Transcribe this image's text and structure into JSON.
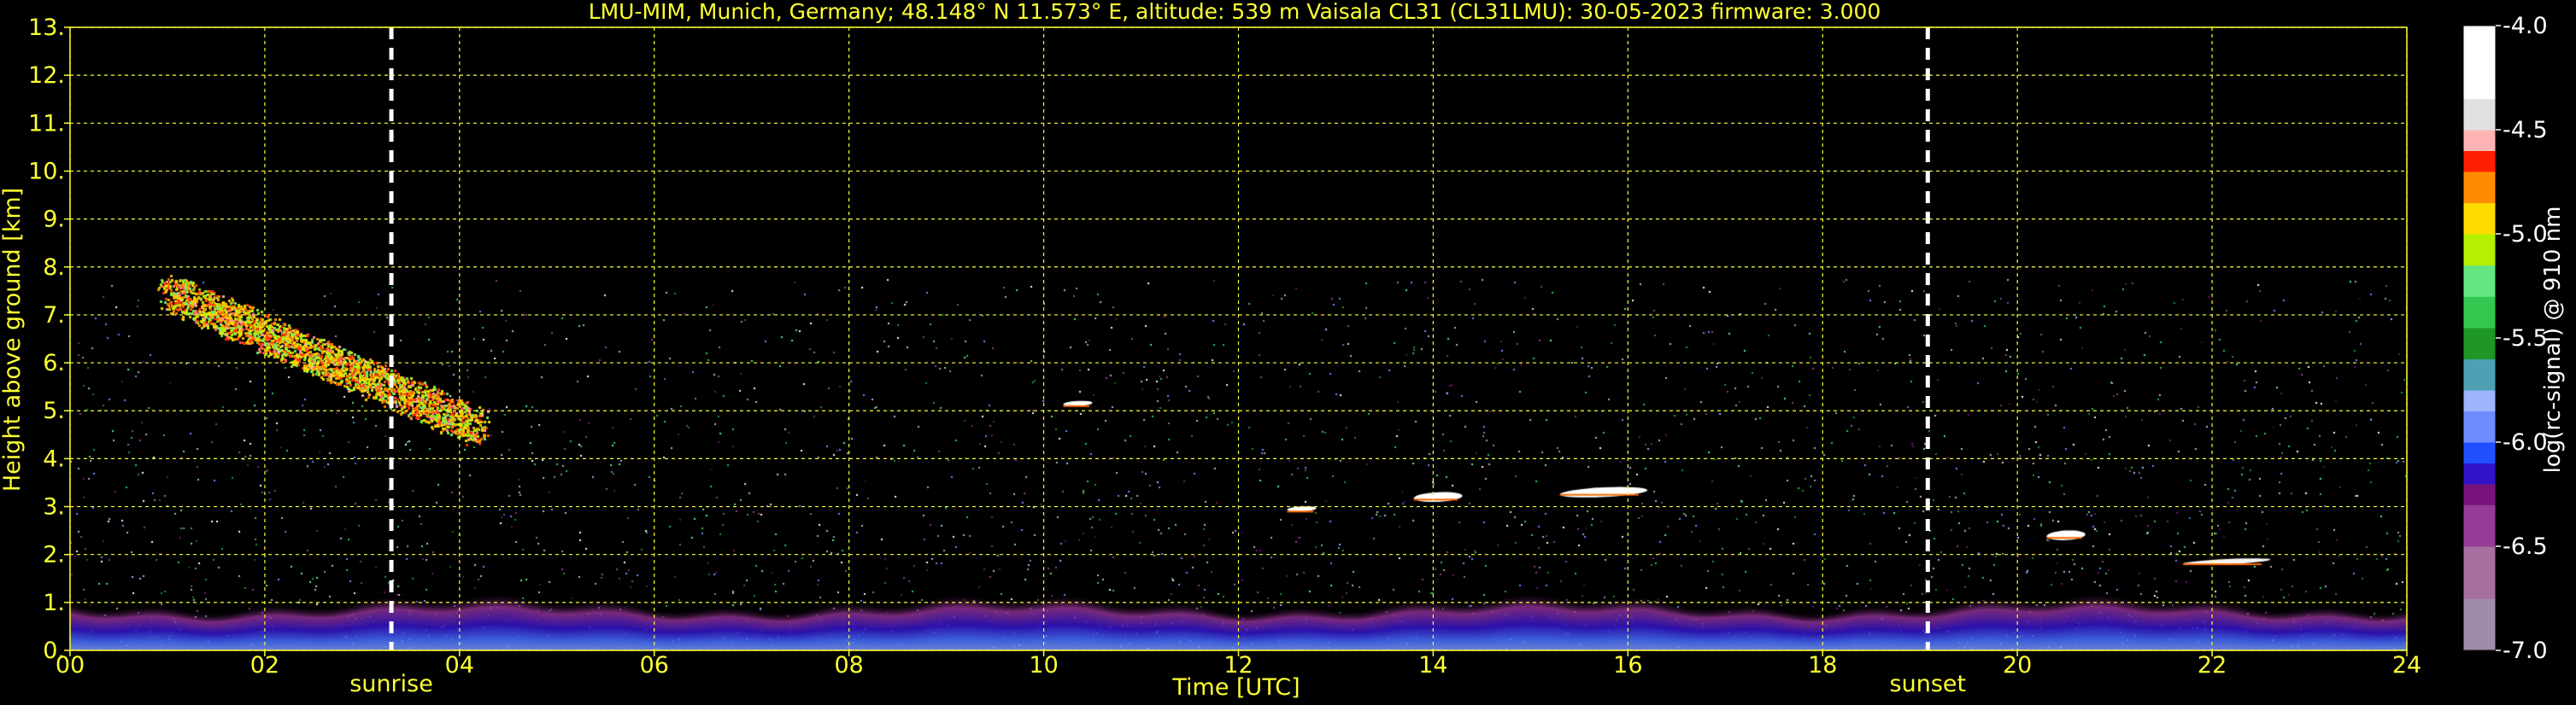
{
  "chart_data": {
    "type": "heatmap",
    "title": "LMU-MIM, Munich, Germany; 48.148° N 11.573° E, altitude: 539 m    Vaisala CL31 (CL31LMU): 30-05-2023    firmware: 3.000",
    "xlabel": "Time [UTC]",
    "ylabel": "Height above ground [km]",
    "xlim": [
      0,
      24
    ],
    "ylim": [
      0,
      13
    ],
    "x_tick_labels": [
      "00",
      "02",
      "04",
      "06",
      "08",
      "10",
      "12",
      "14",
      "16",
      "18",
      "20",
      "22",
      "24"
    ],
    "y_tick_labels": [
      "0.",
      "1.",
      "2.",
      "3.",
      "4.",
      "5.",
      "6.",
      "7.",
      "8.",
      "9.",
      "10.",
      "11.",
      "12.",
      "13."
    ],
    "grid": true,
    "data_max_height_km": 7.75,
    "events": [
      {
        "label": "sunrise",
        "time_utc": 3.3
      },
      {
        "label": "sunset",
        "time_utc": 19.08
      }
    ],
    "colorbar": {
      "label": "log(rc-signal) @ 910 nm",
      "range": [
        -7.0,
        -4.0
      ],
      "ticks": [
        "-4.0",
        "-4.5",
        "-5.0",
        "-5.5",
        "-6.0",
        "-6.5",
        "-7.0"
      ],
      "stops": [
        {
          "v": -7.0,
          "c": "#a08ca8"
        },
        {
          "v": -6.75,
          "c": "#a86ea0"
        },
        {
          "v": -6.5,
          "c": "#963c96"
        },
        {
          "v": -6.3,
          "c": "#78127c"
        },
        {
          "v": -6.2,
          "c": "#3214c8"
        },
        {
          "v": -6.1,
          "c": "#1e50ff"
        },
        {
          "v": -6.0,
          "c": "#6e8cff"
        },
        {
          "v": -5.85,
          "c": "#a0b4ff"
        },
        {
          "v": -5.75,
          "c": "#50a0b4"
        },
        {
          "v": -5.6,
          "c": "#1e9628"
        },
        {
          "v": -5.45,
          "c": "#32c850"
        },
        {
          "v": -5.3,
          "c": "#64e682"
        },
        {
          "v": -5.15,
          "c": "#b4f000"
        },
        {
          "v": -5.0,
          "c": "#ffdc00"
        },
        {
          "v": -4.85,
          "c": "#ff8c00"
        },
        {
          "v": -4.7,
          "c": "#ff1e00"
        },
        {
          "v": -4.6,
          "c": "#ffb4b4"
        },
        {
          "v": -4.5,
          "c": "#e1e1e1"
        },
        {
          "v": -4.35,
          "c": "#ffffff"
        },
        {
          "v": -4.0,
          "c": "#ffffff"
        }
      ]
    },
    "features": [
      {
        "name": "surface aerosol layer",
        "t0": 0,
        "t1": 24,
        "h0": 0,
        "h1": 1.0,
        "level": -6.2
      },
      {
        "name": "elevated aerosol plume",
        "t0": 1.0,
        "t1": 4.2,
        "h0": 4.5,
        "h1": 7.5,
        "level": -4.8
      },
      {
        "name": "cloud 1",
        "t0": 10.2,
        "t1": 10.5,
        "h0": 5.1,
        "h1": 5.2,
        "level": -4.2
      },
      {
        "name": "cloud 2",
        "t0": 12.5,
        "t1": 12.8,
        "h0": 2.9,
        "h1": 3.0,
        "level": -4.2
      },
      {
        "name": "cloud 3",
        "t0": 13.8,
        "t1": 14.3,
        "h0": 3.1,
        "h1": 3.3,
        "level": -4.2
      },
      {
        "name": "cloud 4",
        "t0": 15.3,
        "t1": 16.2,
        "h0": 3.2,
        "h1": 3.4,
        "level": -4.2
      },
      {
        "name": "cloud 5",
        "t0": 20.3,
        "t1": 20.7,
        "h0": 2.3,
        "h1": 2.5,
        "level": -4.3
      },
      {
        "name": "cloud 6",
        "t0": 21.7,
        "t1": 22.6,
        "h0": 1.8,
        "h1": 1.9,
        "level": -4.4
      }
    ]
  }
}
